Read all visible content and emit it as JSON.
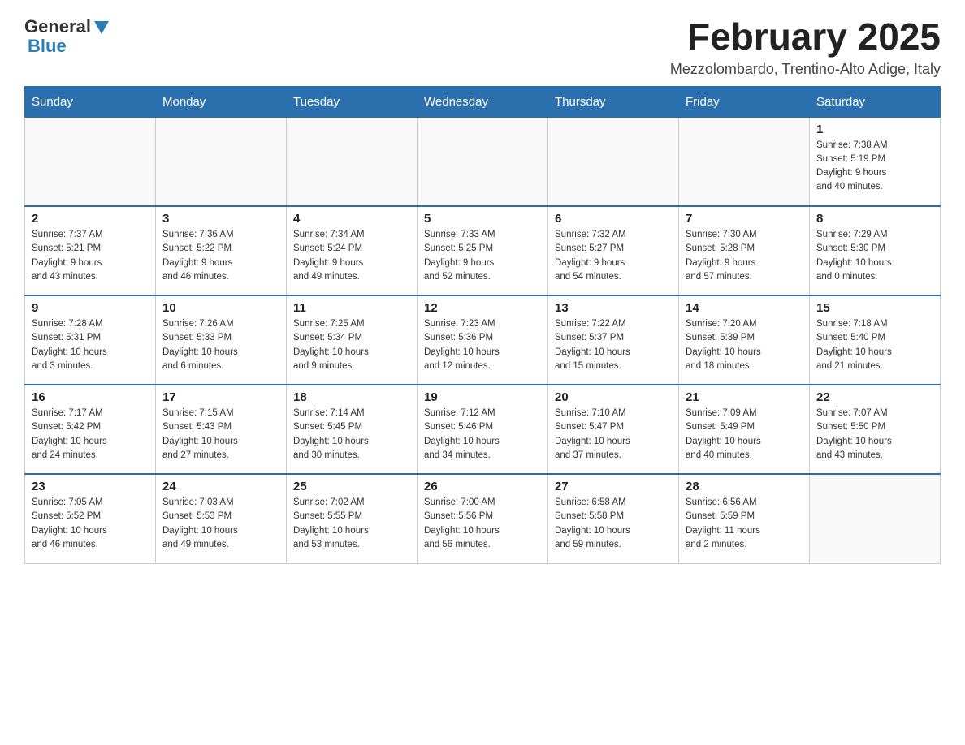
{
  "header": {
    "logo_general": "General",
    "logo_blue": "Blue",
    "month_title": "February 2025",
    "location": "Mezzolombardo, Trentino-Alto Adige, Italy"
  },
  "days_of_week": [
    "Sunday",
    "Monday",
    "Tuesday",
    "Wednesday",
    "Thursday",
    "Friday",
    "Saturday"
  ],
  "weeks": [
    [
      {
        "day": "",
        "info": ""
      },
      {
        "day": "",
        "info": ""
      },
      {
        "day": "",
        "info": ""
      },
      {
        "day": "",
        "info": ""
      },
      {
        "day": "",
        "info": ""
      },
      {
        "day": "",
        "info": ""
      },
      {
        "day": "1",
        "info": "Sunrise: 7:38 AM\nSunset: 5:19 PM\nDaylight: 9 hours\nand 40 minutes."
      }
    ],
    [
      {
        "day": "2",
        "info": "Sunrise: 7:37 AM\nSunset: 5:21 PM\nDaylight: 9 hours\nand 43 minutes."
      },
      {
        "day": "3",
        "info": "Sunrise: 7:36 AM\nSunset: 5:22 PM\nDaylight: 9 hours\nand 46 minutes."
      },
      {
        "day": "4",
        "info": "Sunrise: 7:34 AM\nSunset: 5:24 PM\nDaylight: 9 hours\nand 49 minutes."
      },
      {
        "day": "5",
        "info": "Sunrise: 7:33 AM\nSunset: 5:25 PM\nDaylight: 9 hours\nand 52 minutes."
      },
      {
        "day": "6",
        "info": "Sunrise: 7:32 AM\nSunset: 5:27 PM\nDaylight: 9 hours\nand 54 minutes."
      },
      {
        "day": "7",
        "info": "Sunrise: 7:30 AM\nSunset: 5:28 PM\nDaylight: 9 hours\nand 57 minutes."
      },
      {
        "day": "8",
        "info": "Sunrise: 7:29 AM\nSunset: 5:30 PM\nDaylight: 10 hours\nand 0 minutes."
      }
    ],
    [
      {
        "day": "9",
        "info": "Sunrise: 7:28 AM\nSunset: 5:31 PM\nDaylight: 10 hours\nand 3 minutes."
      },
      {
        "day": "10",
        "info": "Sunrise: 7:26 AM\nSunset: 5:33 PM\nDaylight: 10 hours\nand 6 minutes."
      },
      {
        "day": "11",
        "info": "Sunrise: 7:25 AM\nSunset: 5:34 PM\nDaylight: 10 hours\nand 9 minutes."
      },
      {
        "day": "12",
        "info": "Sunrise: 7:23 AM\nSunset: 5:36 PM\nDaylight: 10 hours\nand 12 minutes."
      },
      {
        "day": "13",
        "info": "Sunrise: 7:22 AM\nSunset: 5:37 PM\nDaylight: 10 hours\nand 15 minutes."
      },
      {
        "day": "14",
        "info": "Sunrise: 7:20 AM\nSunset: 5:39 PM\nDaylight: 10 hours\nand 18 minutes."
      },
      {
        "day": "15",
        "info": "Sunrise: 7:18 AM\nSunset: 5:40 PM\nDaylight: 10 hours\nand 21 minutes."
      }
    ],
    [
      {
        "day": "16",
        "info": "Sunrise: 7:17 AM\nSunset: 5:42 PM\nDaylight: 10 hours\nand 24 minutes."
      },
      {
        "day": "17",
        "info": "Sunrise: 7:15 AM\nSunset: 5:43 PM\nDaylight: 10 hours\nand 27 minutes."
      },
      {
        "day": "18",
        "info": "Sunrise: 7:14 AM\nSunset: 5:45 PM\nDaylight: 10 hours\nand 30 minutes."
      },
      {
        "day": "19",
        "info": "Sunrise: 7:12 AM\nSunset: 5:46 PM\nDaylight: 10 hours\nand 34 minutes."
      },
      {
        "day": "20",
        "info": "Sunrise: 7:10 AM\nSunset: 5:47 PM\nDaylight: 10 hours\nand 37 minutes."
      },
      {
        "day": "21",
        "info": "Sunrise: 7:09 AM\nSunset: 5:49 PM\nDaylight: 10 hours\nand 40 minutes."
      },
      {
        "day": "22",
        "info": "Sunrise: 7:07 AM\nSunset: 5:50 PM\nDaylight: 10 hours\nand 43 minutes."
      }
    ],
    [
      {
        "day": "23",
        "info": "Sunrise: 7:05 AM\nSunset: 5:52 PM\nDaylight: 10 hours\nand 46 minutes."
      },
      {
        "day": "24",
        "info": "Sunrise: 7:03 AM\nSunset: 5:53 PM\nDaylight: 10 hours\nand 49 minutes."
      },
      {
        "day": "25",
        "info": "Sunrise: 7:02 AM\nSunset: 5:55 PM\nDaylight: 10 hours\nand 53 minutes."
      },
      {
        "day": "26",
        "info": "Sunrise: 7:00 AM\nSunset: 5:56 PM\nDaylight: 10 hours\nand 56 minutes."
      },
      {
        "day": "27",
        "info": "Sunrise: 6:58 AM\nSunset: 5:58 PM\nDaylight: 10 hours\nand 59 minutes."
      },
      {
        "day": "28",
        "info": "Sunrise: 6:56 AM\nSunset: 5:59 PM\nDaylight: 11 hours\nand 2 minutes."
      },
      {
        "day": "",
        "info": ""
      }
    ]
  ]
}
